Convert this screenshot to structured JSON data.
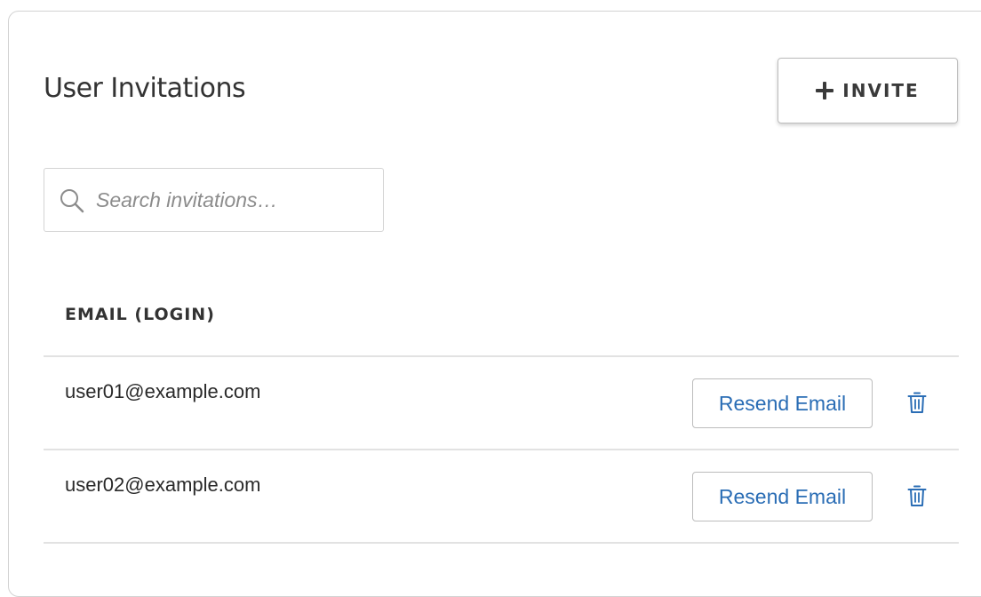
{
  "header": {
    "title": "User Invitations",
    "invite_label": "INVITE"
  },
  "search": {
    "placeholder": "Search invitations…",
    "value": ""
  },
  "table": {
    "columns": [
      "EMAIL (LOGIN)"
    ],
    "rows": [
      {
        "email": "user01@example.com",
        "action_label": "Resend Email"
      },
      {
        "email": "user02@example.com",
        "action_label": "Resend Email"
      }
    ]
  },
  "icons": {
    "invite": "plus-icon",
    "search": "search-icon",
    "delete": "trash-icon"
  },
  "colors": {
    "accent_link": "#2a6db5",
    "text": "#333333",
    "border": "#d2d2d2"
  }
}
